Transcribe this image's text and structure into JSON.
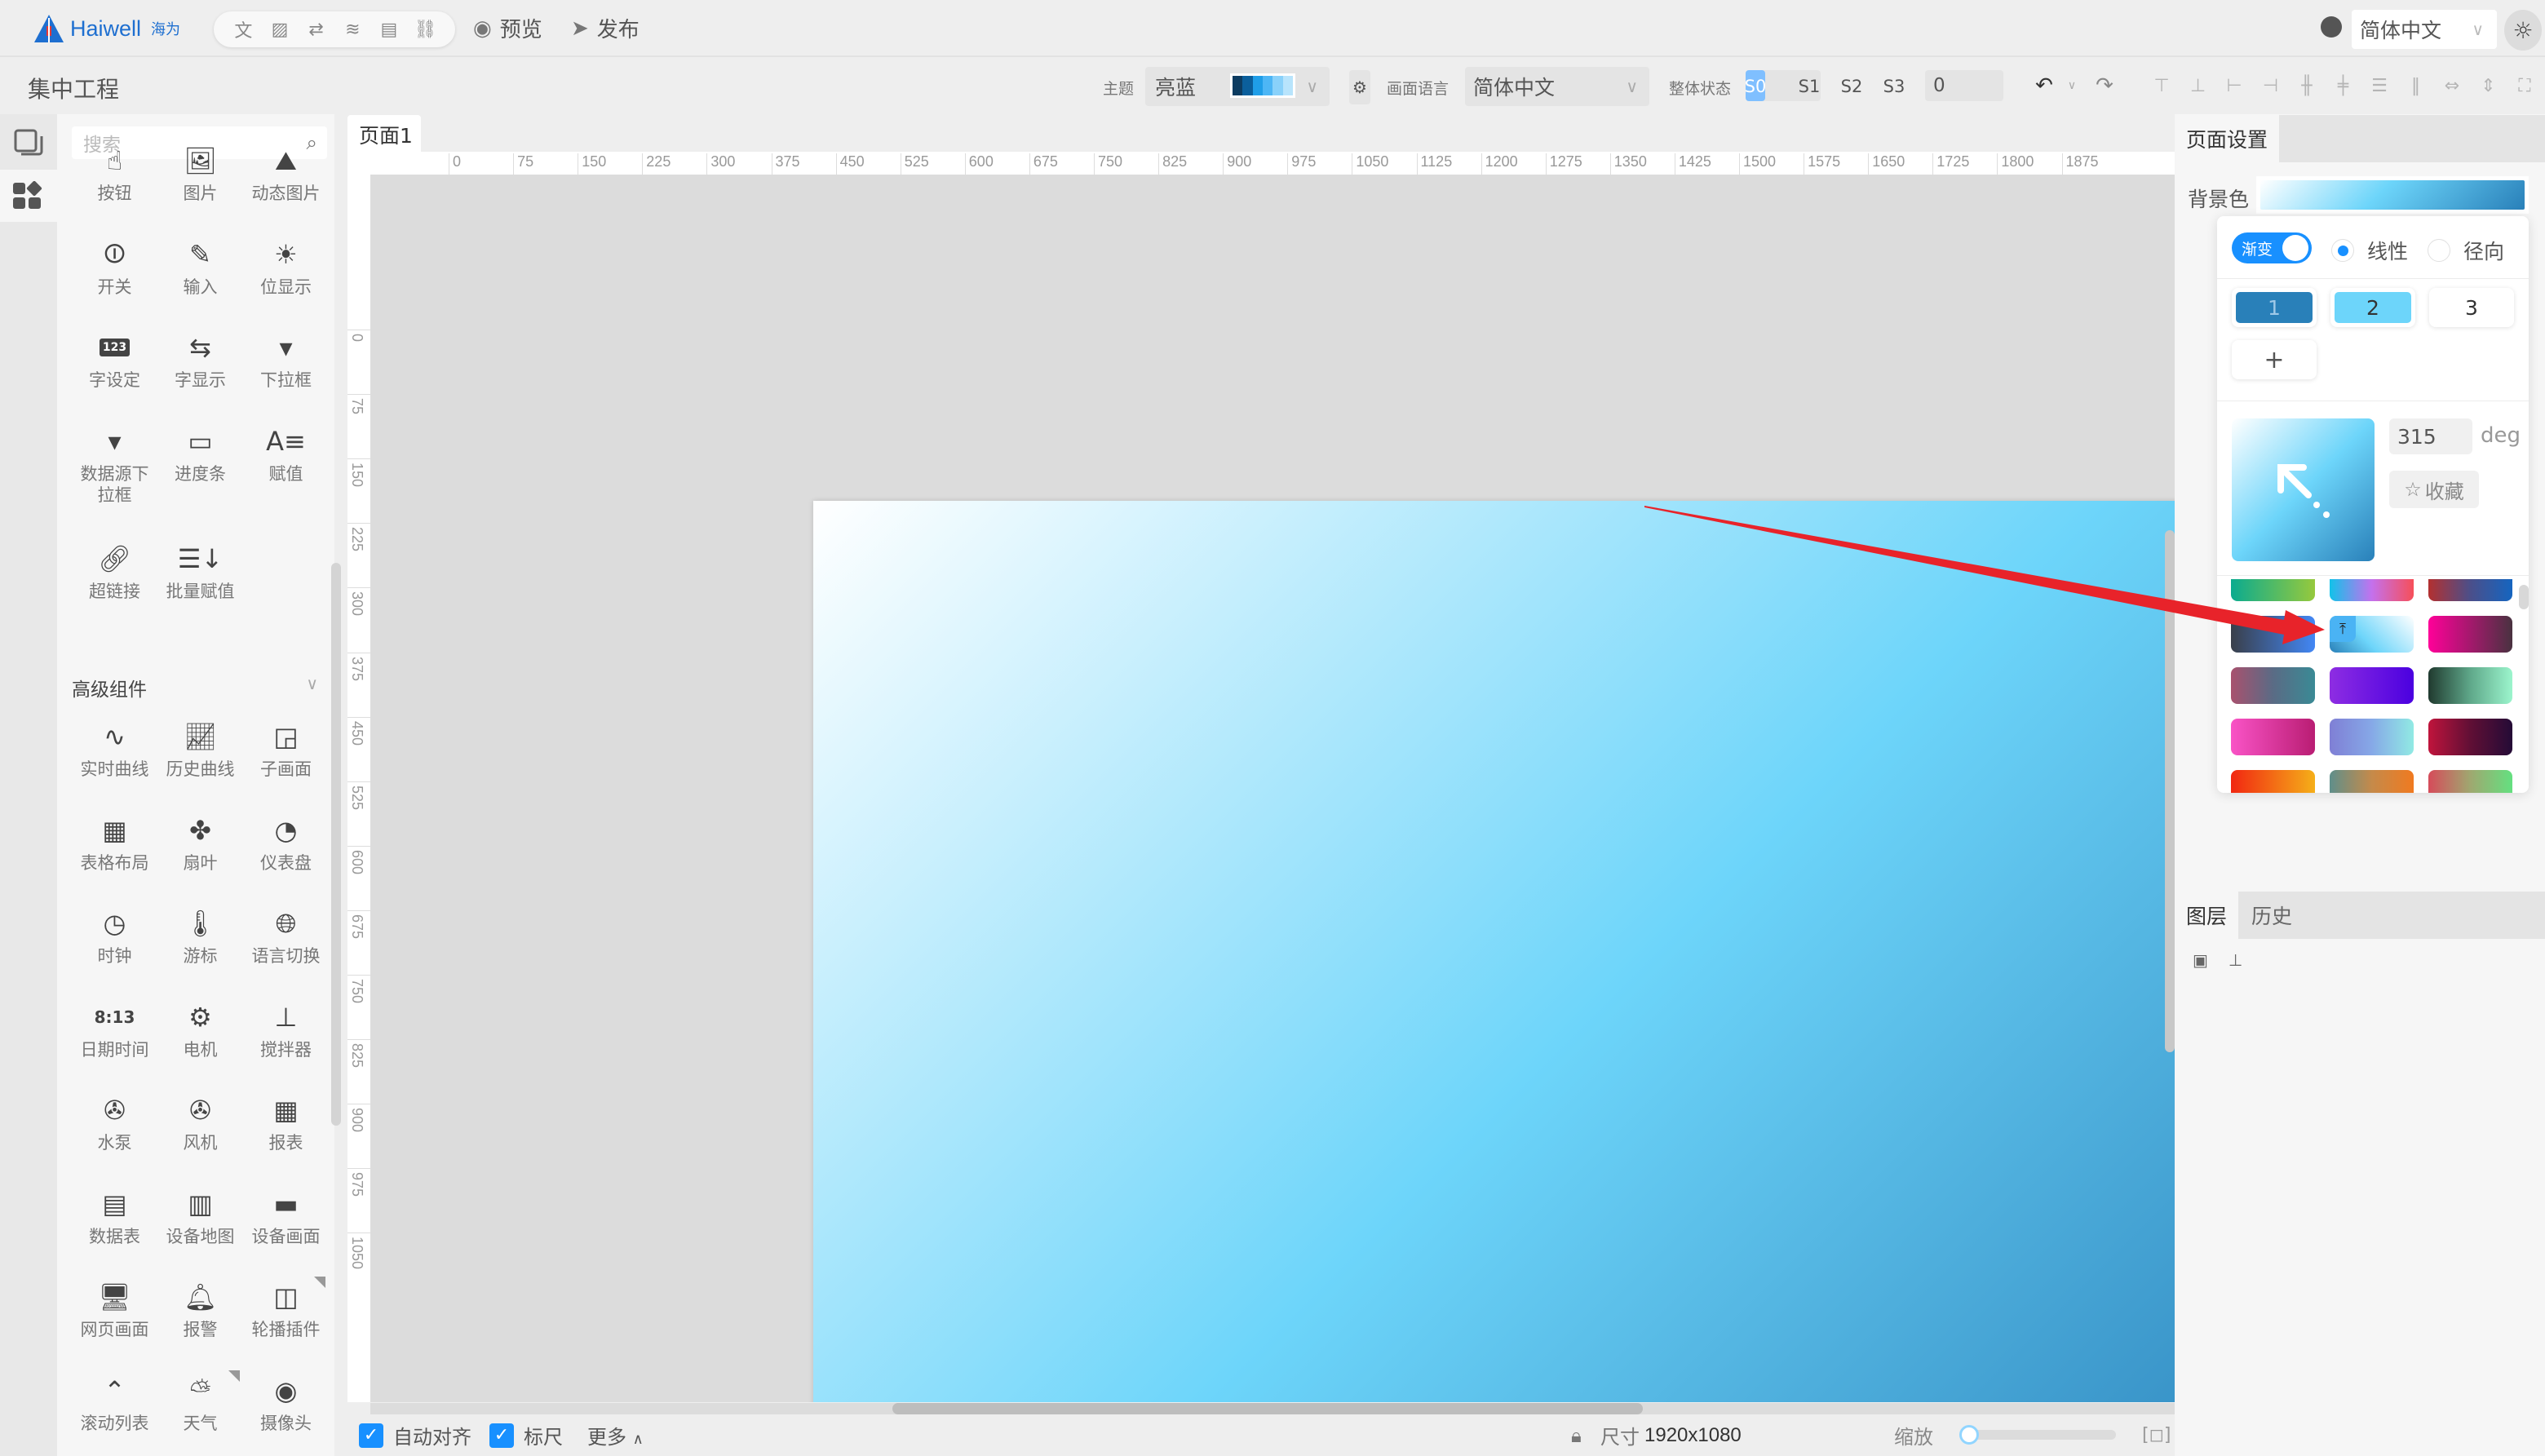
{
  "app": {
    "brand": "Haiwell",
    "brand_cn": "海为",
    "project_title": "集中工程"
  },
  "topbar": {
    "tool_icons": [
      "translate-icon",
      "image-icon",
      "variable-icon",
      "layers-icon",
      "document-icon",
      "link-icon"
    ],
    "preview_label": "预览",
    "publish_label": "发布",
    "language_value": "简体中文",
    "theme_toggle_icon": "sun-icon"
  },
  "toolbar": {
    "theme_label": "主题",
    "theme_value": "亮蓝",
    "theme_palette": [
      "#0d3c61",
      "#0b5f9c",
      "#1f9ee8",
      "#4db6f5",
      "#89d1fa",
      "#b8e4fc"
    ],
    "canvas_lang_label": "画面语言",
    "canvas_lang_value": "简体中文",
    "overall_state_label": "整体状态",
    "states": [
      "S0",
      "S1",
      "S2",
      "S3"
    ],
    "active_state": "S0",
    "state_value": "0",
    "align_tools": [
      "align-top-icon",
      "align-bottom-icon",
      "align-left-icon",
      "align-right-icon",
      "align-h-center-icon",
      "align-v-center-icon",
      "distribute-h-icon",
      "distribute-v-icon",
      "same-width-icon",
      "same-height-icon",
      "fit-icon"
    ]
  },
  "left_panel": {
    "search_placeholder": "搜索",
    "basic_components": [
      {
        "label": "按钮",
        "icon": "button-icon"
      },
      {
        "label": "图片",
        "icon": "image-icon"
      },
      {
        "label": "动态图片",
        "icon": "dynamic-image-icon"
      },
      {
        "label": "开关",
        "icon": "switch-icon"
      },
      {
        "label": "输入",
        "icon": "input-icon"
      },
      {
        "label": "位显示",
        "icon": "bit-display-icon"
      },
      {
        "label": "字设定",
        "icon": "word-set-icon"
      },
      {
        "label": "字显示",
        "icon": "word-display-icon"
      },
      {
        "label": "下拉框",
        "icon": "dropdown-icon"
      },
      {
        "label": "数据源下拉框",
        "icon": "datasource-dropdown-icon"
      },
      {
        "label": "进度条",
        "icon": "progress-icon"
      },
      {
        "label": "赋值",
        "icon": "assign-icon"
      },
      {
        "label": "超链接",
        "icon": "hyperlink-icon"
      },
      {
        "label": "批量赋值",
        "icon": "batch-assign-icon"
      }
    ],
    "advanced_title": "高级组件",
    "advanced_components": [
      {
        "label": "实时曲线",
        "icon": "realtime-curve-icon"
      },
      {
        "label": "历史曲线",
        "icon": "history-curve-icon"
      },
      {
        "label": "子画面",
        "icon": "subscreen-icon"
      },
      {
        "label": "表格布局",
        "icon": "table-layout-icon"
      },
      {
        "label": "扇叶",
        "icon": "fan-blade-icon"
      },
      {
        "label": "仪表盘",
        "icon": "gauge-icon"
      },
      {
        "label": "时钟",
        "icon": "clock-icon"
      },
      {
        "label": "游标",
        "icon": "thermometer-icon"
      },
      {
        "label": "语言切换",
        "icon": "globe-icon"
      },
      {
        "label": "日期时间",
        "icon": "datetime-icon"
      },
      {
        "label": "电机",
        "icon": "motor-icon"
      },
      {
        "label": "搅拌器",
        "icon": "mixer-icon"
      },
      {
        "label": "水泵",
        "icon": "pump-icon"
      },
      {
        "label": "风机",
        "icon": "blower-icon"
      },
      {
        "label": "报表",
        "icon": "report-icon"
      },
      {
        "label": "数据表",
        "icon": "datatable-icon"
      },
      {
        "label": "设备地图",
        "icon": "map-icon"
      },
      {
        "label": "设备画面",
        "icon": "device-screen-icon"
      },
      {
        "label": "网页画面",
        "icon": "monitor-icon"
      },
      {
        "label": "报警",
        "icon": "bell-icon"
      },
      {
        "label": "轮播插件",
        "icon": "carousel-icon"
      },
      {
        "label": "滚动列表",
        "icon": "scroll-list-icon"
      },
      {
        "label": "天气",
        "icon": "weather-icon"
      },
      {
        "label": "摄像头",
        "icon": "camera-icon"
      }
    ]
  },
  "canvas": {
    "page_tab": "页面1",
    "h_ruler": [
      "0",
      "75",
      "150",
      "225",
      "300",
      "375",
      "450",
      "525",
      "600",
      "675",
      "750",
      "825",
      "900",
      "975",
      "1050",
      "1125",
      "1200",
      "1275",
      "1350",
      "1425",
      "1500",
      "1575",
      "1650",
      "1725",
      "1800",
      "1875"
    ],
    "v_ruler": [
      "0",
      "75",
      "150",
      "225",
      "300",
      "375",
      "450",
      "525",
      "600",
      "675",
      "750",
      "825",
      "900",
      "975",
      "1050"
    ],
    "background_gradient": {
      "angle_deg": 315,
      "stops": [
        "#ffffff",
        "#6dd5fa",
        "#2980b9"
      ]
    }
  },
  "bottombar": {
    "auto_align_label": "自动对齐",
    "auto_align_checked": true,
    "ruler_label": "标尺",
    "ruler_checked": true,
    "more_label": "更多",
    "size_label": "尺寸",
    "size_value": "1920x1080",
    "zoom_label": "缩放",
    "zoom_fraction": 0.02
  },
  "right_panel": {
    "page_settings_tab": "页面设置",
    "bg_color_label": "背景色",
    "gradient_toggle_label": "渐变",
    "gradient_on": true,
    "linear_label": "线性",
    "radial_label": "径向",
    "selected_type": "linear",
    "stops": [
      {
        "label": "1",
        "color": "#2980b9"
      },
      {
        "label": "2",
        "color": "#6dd5fa"
      },
      {
        "label": "3",
        "color": "#ffffff"
      }
    ],
    "add_stop_label": "+",
    "angle_value": "315",
    "angle_unit": "deg",
    "favorite_label": "收藏",
    "presets": [
      [
        "#0bab8f",
        "#96c93d"
      ],
      [
        "#12c2e9",
        "#c471ed",
        "#f64f59"
      ],
      [
        "#b33030",
        "#4b4f8a",
        "#1565c0"
      ],
      [
        "#3a3f4a",
        "#4287f5"
      ],
      [
        "#2980b9",
        "#6dd5fa",
        "#ffffff"
      ],
      [
        "#ff0099",
        "#493240"
      ],
      [
        "#a8516e",
        "#5a6b85",
        "#3a8a95"
      ],
      [
        "#8e2de2",
        "#4a00e0"
      ],
      [
        "#203a2f",
        "#5fa88a",
        "#9cf5cd"
      ],
      [
        "#f953c6",
        "#b91d73"
      ],
      [
        "#7f7fd5",
        "#86a8e7",
        "#91eae4"
      ],
      [
        "#c0143c",
        "#600f35",
        "#240b36"
      ],
      [
        "#f12711",
        "#f5af19"
      ],
      [
        "#5f8f8b",
        "#c58a4a",
        "#f07a20"
      ],
      [
        "#d64b5a",
        "#9fa870",
        "#64e080"
      ]
    ],
    "layers_tab": "图层",
    "history_tab": "历史"
  }
}
